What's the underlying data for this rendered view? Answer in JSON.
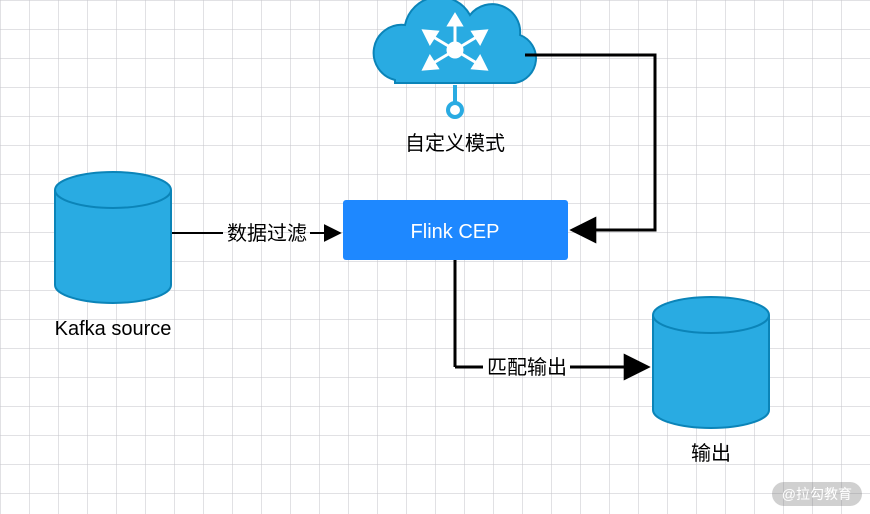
{
  "nodes": {
    "kafka": {
      "label": "Kafka source"
    },
    "custom_pattern": {
      "label": "自定义模式"
    },
    "flink_cep": {
      "label": "Flink CEP"
    },
    "output": {
      "label": "输出"
    }
  },
  "edges": {
    "filter": {
      "label": "数据过滤"
    },
    "pattern_in": {
      "label": ""
    },
    "match_out": {
      "label": "匹配输出"
    }
  },
  "watermark": "@拉勾教育",
  "colors": {
    "cyan": "#29abe2",
    "blue": "#1e88ff"
  }
}
